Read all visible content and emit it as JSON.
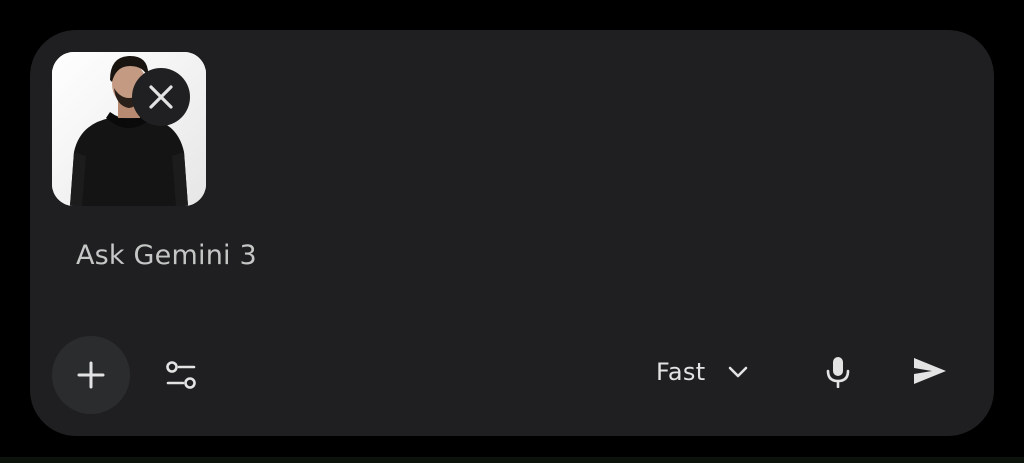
{
  "composer": {
    "attachment": {
      "type": "image",
      "remove_icon": "close-icon"
    },
    "prompt_placeholder": "Ask Gemini 3",
    "toolbar": {
      "add_icon": "plus-icon",
      "tools_icon": "tune-icon",
      "mode_label": "Fast",
      "mode_chevron_icon": "chevron-down-icon",
      "mic_icon": "mic-icon",
      "send_icon": "send-icon"
    }
  },
  "colors": {
    "page_background": "#000000",
    "composer_background": "#1f1f21",
    "placeholder_text": "#c4c7c5",
    "icon": "#e3e3e3",
    "add_button_background": "#2b2c2e"
  }
}
